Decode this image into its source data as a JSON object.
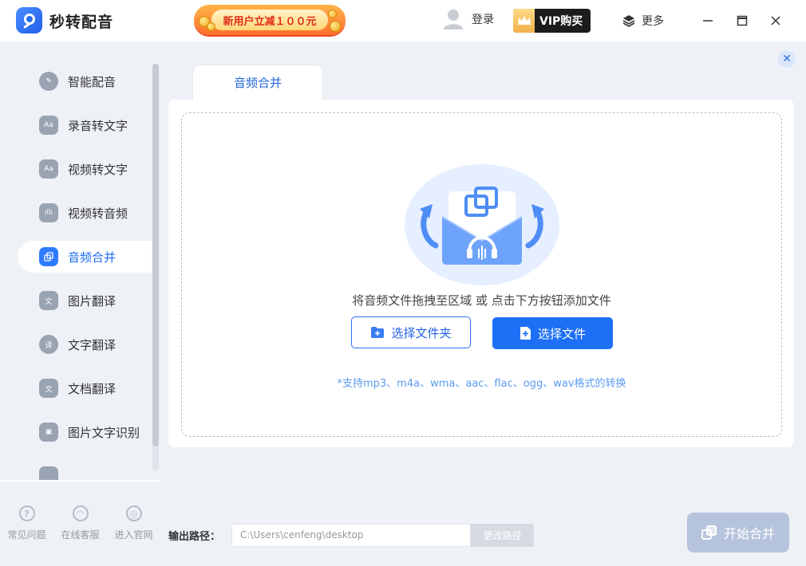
{
  "app": {
    "name": "秒转配音"
  },
  "header": {
    "promo_text": "新用户立减１００元",
    "login_label": "登录",
    "vip_label": "VIP购买",
    "more_label": "更多"
  },
  "sidebar": {
    "items": [
      {
        "label": "智能配音",
        "icon": "voice-icon"
      },
      {
        "label": "录音转文字",
        "icon": "record-text-icon"
      },
      {
        "label": "视频转文字",
        "icon": "video-text-icon"
      },
      {
        "label": "视频转音频",
        "icon": "video-audio-icon"
      },
      {
        "label": "音频合并",
        "icon": "audio-merge-icon",
        "active": true
      },
      {
        "label": "图片翻译",
        "icon": "image-translate-icon"
      },
      {
        "label": "文字翻译",
        "icon": "text-translate-icon"
      },
      {
        "label": "文档翻译",
        "icon": "doc-translate-icon"
      },
      {
        "label": "图片文字识别",
        "icon": "ocr-icon"
      }
    ],
    "bottom_links": [
      {
        "label": "常见问题",
        "icon": "help-icon"
      },
      {
        "label": "在线客服",
        "icon": "support-icon"
      },
      {
        "label": "进入官网",
        "icon": "website-icon"
      }
    ]
  },
  "main": {
    "tab_label": "音频合并",
    "drop_hint": "将音频文件拖拽至区域 或 点击下方按钮添加文件",
    "select_folder_label": "选择文件夹",
    "select_file_label": "选择文件",
    "support_text": "*支持mp3、m4a、wma、aac、flac、ogg、wav格式的转换"
  },
  "footer": {
    "output_label": "输出路径：",
    "output_path": "C:\\Users\\cenfeng\\desktop",
    "change_path_label": "更改路径",
    "start_label": "开始合并"
  },
  "colors": {
    "accent": "#1d70f5",
    "active_text": "#1e6cf0",
    "disabled_button": "#b6c3dc"
  }
}
